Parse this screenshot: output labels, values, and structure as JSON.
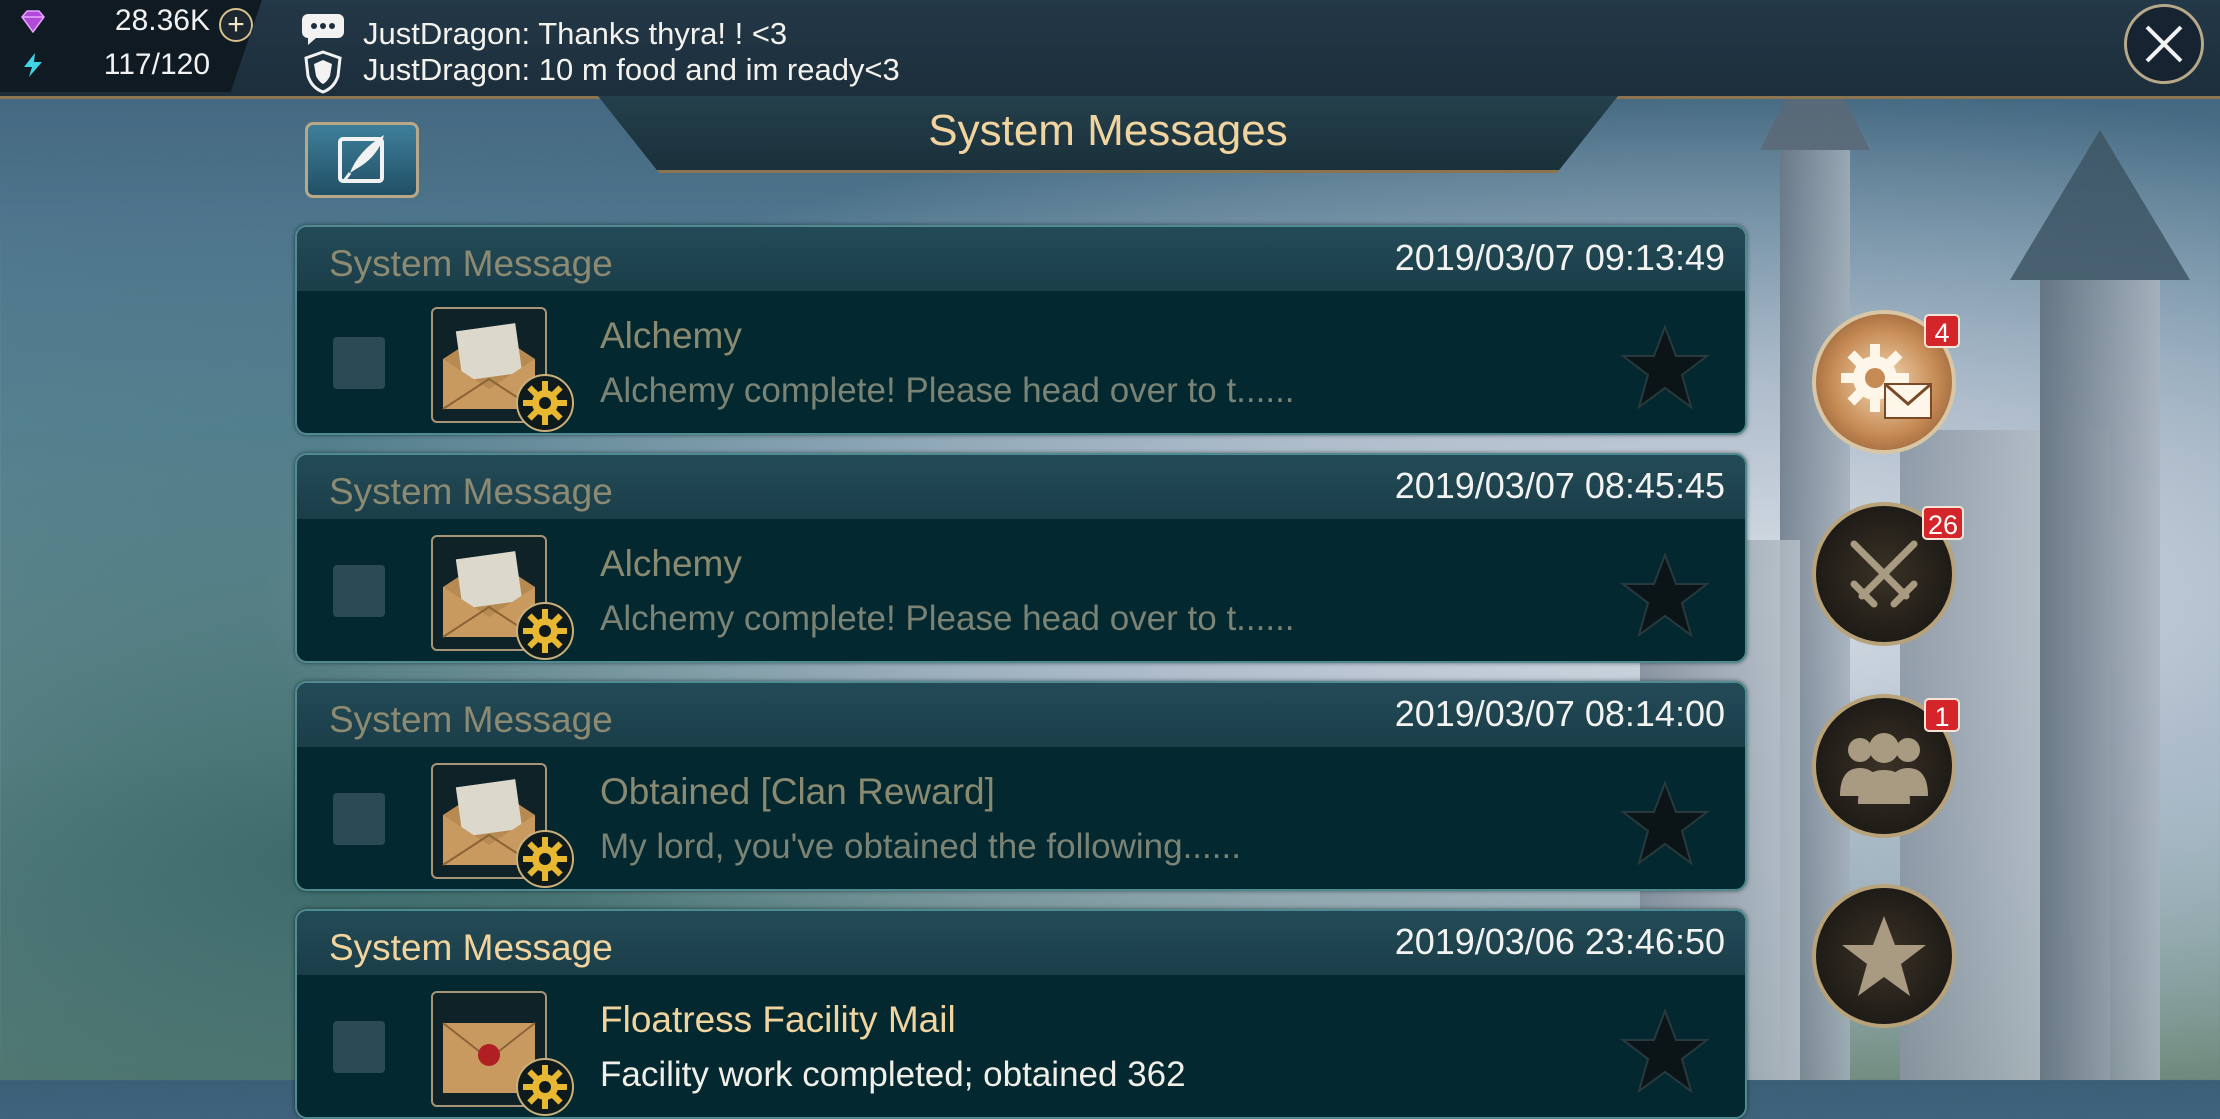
{
  "resources": {
    "gems": "28.36K",
    "stamina": "117/120",
    "gem_icon_color": "#b04ad8",
    "stamina_icon_color": "#3fd4e6"
  },
  "chat": {
    "lines": [
      "JustDragon: Thanks thyra! !  <3",
      "JustDragon: 10 m food and im ready<3"
    ]
  },
  "title": "System Messages",
  "messages": [
    {
      "sender": "System Message",
      "time": "2019/03/07 09:13:49",
      "subject": "Alchemy",
      "preview": "Alchemy complete!  Please head over to t......",
      "read": true,
      "icon": "envelope-open-icon"
    },
    {
      "sender": "System Message",
      "time": "2019/03/07 08:45:45",
      "subject": "Alchemy",
      "preview": "Alchemy complete!  Please head over to t......",
      "read": true,
      "icon": "envelope-open-icon"
    },
    {
      "sender": "System Message",
      "time": "2019/03/07 08:14:00",
      "subject": "Obtained [Clan Reward]",
      "preview": "My lord, you've obtained the following......",
      "read": true,
      "icon": "envelope-open-icon"
    },
    {
      "sender": "System Message",
      "time": "2019/03/06 23:46:50",
      "subject": "Floatress Facility Mail",
      "preview": "Facility work completed; obtained 362",
      "read": false,
      "icon": "sealed-envelope-icon"
    }
  ],
  "side_tabs": [
    {
      "name": "system-mail",
      "icon": "gear-mail-icon",
      "badge": "4",
      "active": true
    },
    {
      "name": "battle-reports",
      "icon": "crossed-swords-icon",
      "badge": "26",
      "active": false
    },
    {
      "name": "clan-mail",
      "icon": "group-icon",
      "badge": "1",
      "active": false
    },
    {
      "name": "favorites",
      "icon": "star-icon",
      "badge": "",
      "active": false
    }
  ]
}
